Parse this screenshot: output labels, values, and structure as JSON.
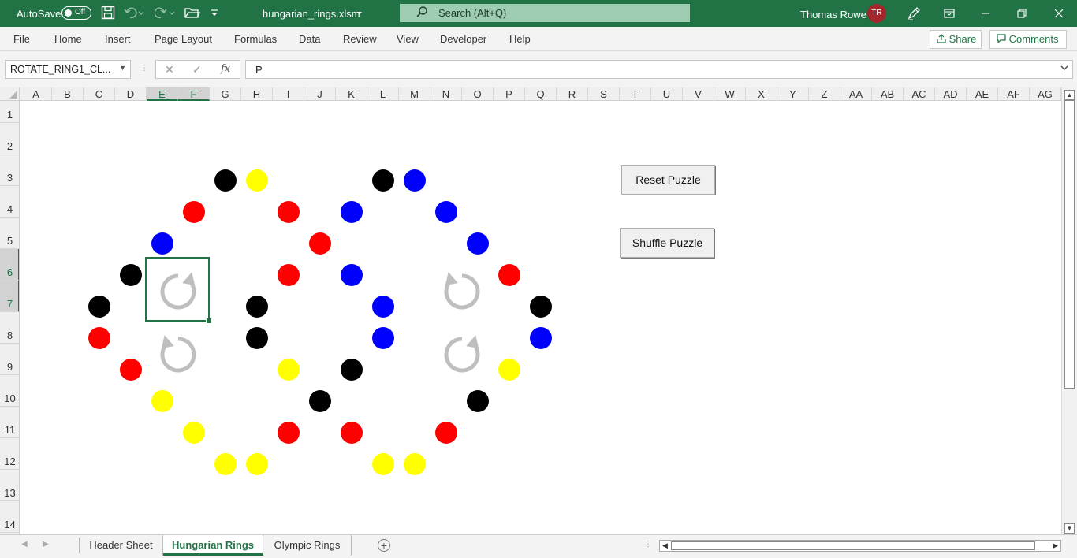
{
  "titlebar": {
    "autosave_label": "AutoSave",
    "autosave_state": "Off",
    "filename": "hungarian_rings.xlsm",
    "search_placeholder": "Search (Alt+Q)",
    "user_name": "Thomas Rowe",
    "user_initials": "TR",
    "color": "#217346"
  },
  "ribbon": {
    "tabs": [
      "File",
      "Home",
      "Insert",
      "Page Layout",
      "Formulas",
      "Data",
      "Review",
      "View",
      "Developer",
      "Help"
    ],
    "share_label": "Share",
    "comments_label": "Comments"
  },
  "formula_bar": {
    "name_box": "ROTATE_RING1_CL...",
    "fx_label": "fx",
    "content": "P"
  },
  "columns": [
    "A",
    "B",
    "C",
    "D",
    "E",
    "F",
    "G",
    "H",
    "I",
    "J",
    "K",
    "L",
    "M",
    "N",
    "O",
    "P",
    "Q",
    "R",
    "S",
    "T",
    "U",
    "V",
    "W",
    "X",
    "Y",
    "Z",
    "AA",
    "AB",
    "AC",
    "AD",
    "AE",
    "AF",
    "AG"
  ],
  "selected_columns": [
    "E",
    "F"
  ],
  "rows": [
    "1",
    "2",
    "3",
    "4",
    "5",
    "6",
    "7",
    "8",
    "9",
    "10",
    "11",
    "12",
    "13",
    "14"
  ],
  "selected_rows": [
    "6",
    "7"
  ],
  "puzzle": {
    "colors": {
      "black": "#000000",
      "yellow": "#ffff00",
      "red": "#ff0000",
      "blue": "#0000ff"
    },
    "balls": [
      "black",
      "yellow",
      "black",
      "blue",
      "red",
      "red",
      "blue",
      "blue",
      "blue",
      "red",
      "blue",
      "black",
      "red",
      "blue",
      "red",
      "black",
      "black",
      "blue",
      "black",
      "red",
      "black",
      "blue",
      "blue",
      "red",
      "yellow",
      "black",
      "yellow",
      "yellow",
      "black",
      "black",
      "yellow",
      "red",
      "red",
      "red",
      "yellow",
      "yellow",
      "yellow",
      "yellow"
    ],
    "rotate_icon_color": "#bfbfbf",
    "reset_label": "Reset Puzzle",
    "shuffle_label": "Shuffle Puzzle"
  },
  "sheets": {
    "tabs": [
      "Header Sheet",
      "Hungarian Rings",
      "Olympic Rings"
    ],
    "active": "Hungarian Rings"
  }
}
